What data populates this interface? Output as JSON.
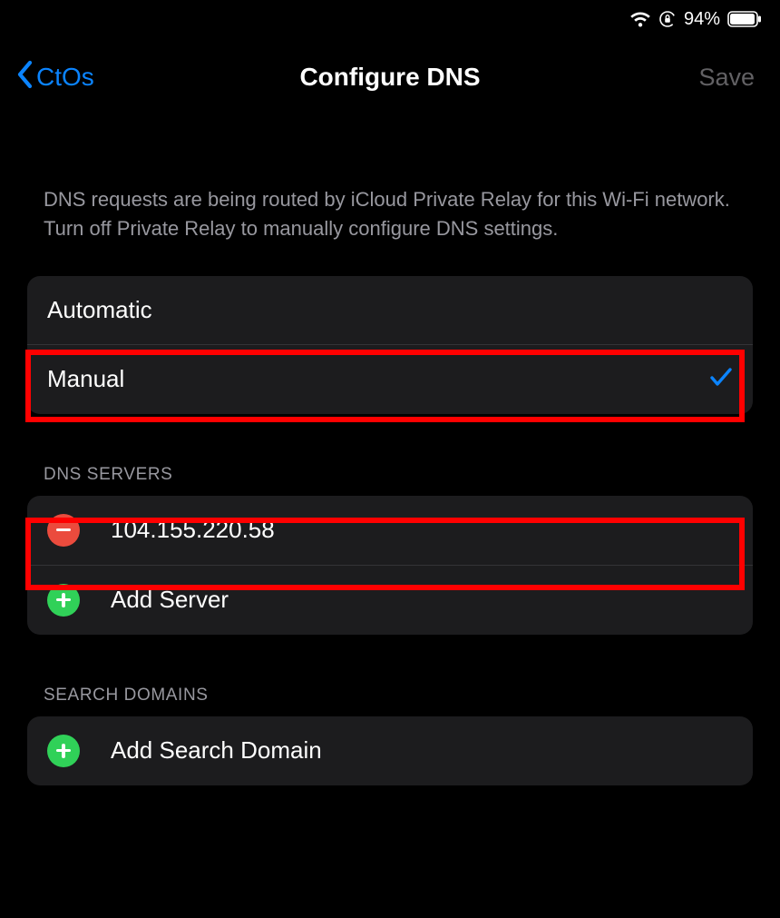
{
  "status": {
    "battery_pct": "94%"
  },
  "nav": {
    "back_label": "CtOs",
    "title": "Configure DNS",
    "save_label": "Save"
  },
  "hint": "DNS requests are being routed by iCloud Private Relay for this Wi-Fi network. Turn off Private Relay to manually configure DNS settings.",
  "dns_mode": {
    "automatic_label": "Automatic",
    "manual_label": "Manual",
    "selected": "manual"
  },
  "sections": {
    "dns_servers_title": "DNS SERVERS",
    "search_domains_title": "SEARCH DOMAINS"
  },
  "dns_servers": [
    {
      "ip": "104.155.220.58"
    }
  ],
  "actions": {
    "add_server_label": "Add Server",
    "add_search_domain_label": "Add Search Domain"
  }
}
